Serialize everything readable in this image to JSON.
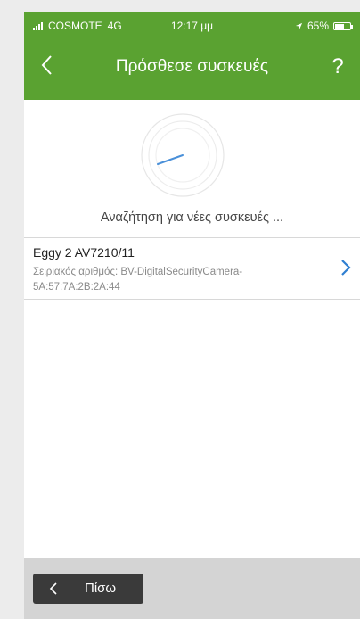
{
  "status_bar": {
    "carrier": "COSMOTE",
    "network": "4G",
    "time": "12:17 μμ",
    "battery": "65%",
    "battery_level": 0.65
  },
  "nav": {
    "title": "Πρόσθεσε συσκευές",
    "help": "?"
  },
  "search": {
    "status_text": "Αναζήτηση για νέες συσκευές ..."
  },
  "devices": [
    {
      "name": "Eggy 2 AV7210/11",
      "serial": "Σειριακός αριθμός: BV-DigitalSecurityCamera-5A:57:7A:2B:2A:44"
    }
  ],
  "bottom": {
    "back_label": "Πίσω"
  },
  "colors": {
    "accent": "#5aa231",
    "spinner": "#4a90d9",
    "chevron": "#2f7fd1"
  }
}
